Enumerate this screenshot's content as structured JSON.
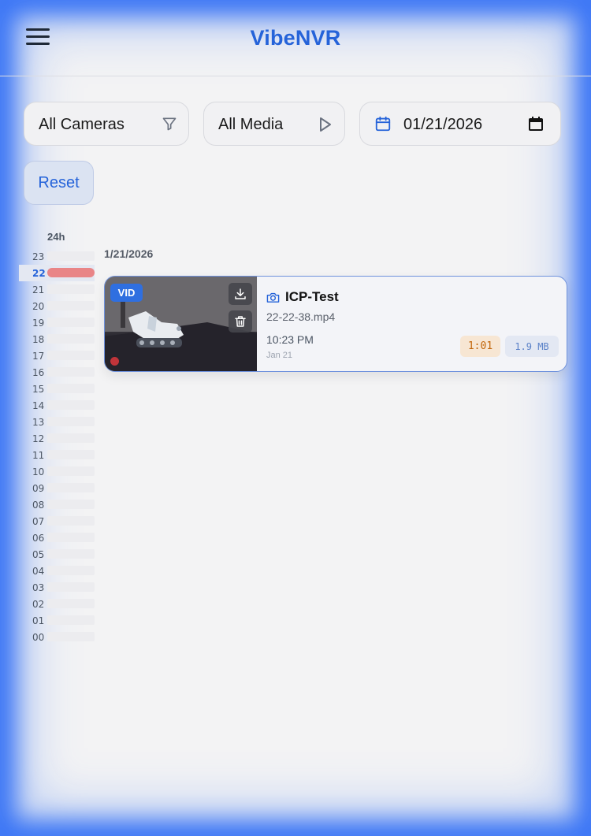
{
  "header": {
    "title": "VibeNVR",
    "menu_icon": "hamburger-menu-icon"
  },
  "filters": {
    "camera": {
      "label": "All Cameras",
      "icon": "filter-icon"
    },
    "media": {
      "label": "All Media",
      "icon": "play-icon"
    },
    "date": {
      "value": "01/21/2026",
      "icon": "calendar-icon",
      "picker_icon": "calendar-picker-icon"
    },
    "reset_label": "Reset"
  },
  "timeline": {
    "header": "24h",
    "hours": [
      "23",
      "22",
      "21",
      "20",
      "19",
      "18",
      "17",
      "16",
      "15",
      "14",
      "13",
      "12",
      "11",
      "10",
      "09",
      "08",
      "07",
      "06",
      "05",
      "04",
      "03",
      "02",
      "01",
      "00"
    ],
    "active_hour": "22",
    "active_color": "#e98587"
  },
  "recordings": {
    "date_heading": "1/21/2026",
    "items": [
      {
        "type_badge": "VID",
        "camera": "ICP-Test",
        "filename": "22-22-38.mp4",
        "time": "10:23 PM",
        "date": "Jan 21",
        "duration": "1:01",
        "size": "1.9 MB"
      }
    ]
  },
  "colors": {
    "accent": "#2563d9",
    "frame_glow": "#2f6df5",
    "badge": "#2f6fe0"
  }
}
